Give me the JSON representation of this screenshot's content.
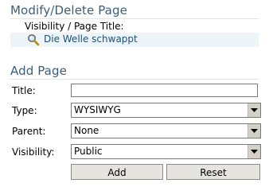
{
  "modify_section": {
    "title": "Modify/Delete Page",
    "subheading": "Visibility / Page Title:",
    "pages": [
      {
        "icon": "magnifier-icon",
        "title": "Die Welle schwappt"
      }
    ]
  },
  "add_section": {
    "title": "Add Page",
    "fields": {
      "title": {
        "label": "Title:",
        "value": ""
      },
      "type": {
        "label": "Type:",
        "value": "WYSIWYG"
      },
      "parent": {
        "label": "Parent:",
        "value": "None"
      },
      "visibility": {
        "label": "Visibility:",
        "value": "Public"
      }
    },
    "buttons": {
      "add": "Add",
      "reset": "Reset"
    }
  },
  "colors": {
    "heading": "#3c5d79",
    "link": "#1c4f75",
    "link_row_bg": "#eef5f9"
  }
}
